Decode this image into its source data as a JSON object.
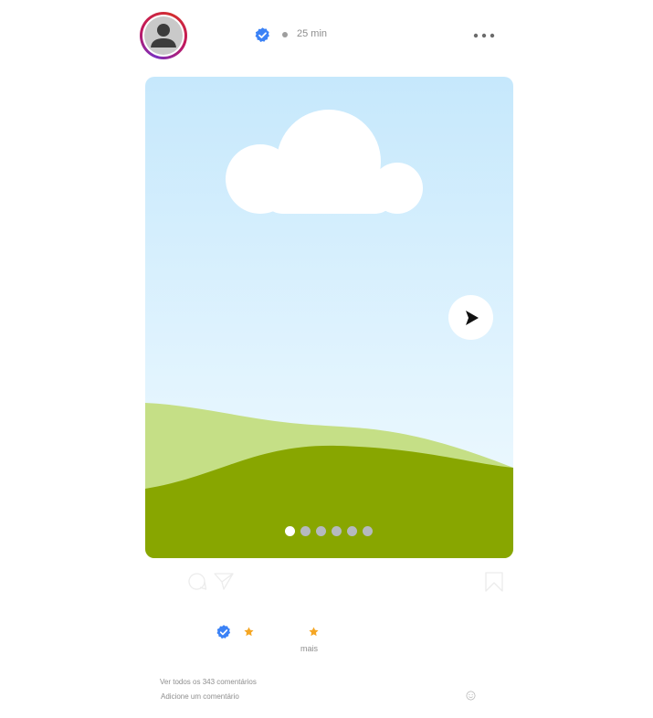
{
  "post": {
    "time_ago": "25 min",
    "carousel": {
      "total": 6,
      "active_index": 0
    }
  },
  "likes": {
    "more_label": "mais"
  },
  "comments": {
    "view_all_label": "Ver todos os 343 comentários",
    "add_comment_placeholder": "Adicione um comentário"
  },
  "icons": {
    "avatar": "user-avatar-icon",
    "verified": "verified-badge-icon",
    "more": "more-options-icon",
    "next": "next-arrow-icon",
    "comment": "comment-icon",
    "share": "share-icon",
    "save": "bookmark-icon",
    "star": "star-icon",
    "emoji": "emoji-icon"
  },
  "colors": {
    "verified_blue": "#3b82f6",
    "star_orange": "#f5a623",
    "sky_top": "#c6e8fc",
    "grass_light": "#c5df86",
    "grass_dark": "#88a600",
    "text_muted": "#8e8e8e"
  }
}
